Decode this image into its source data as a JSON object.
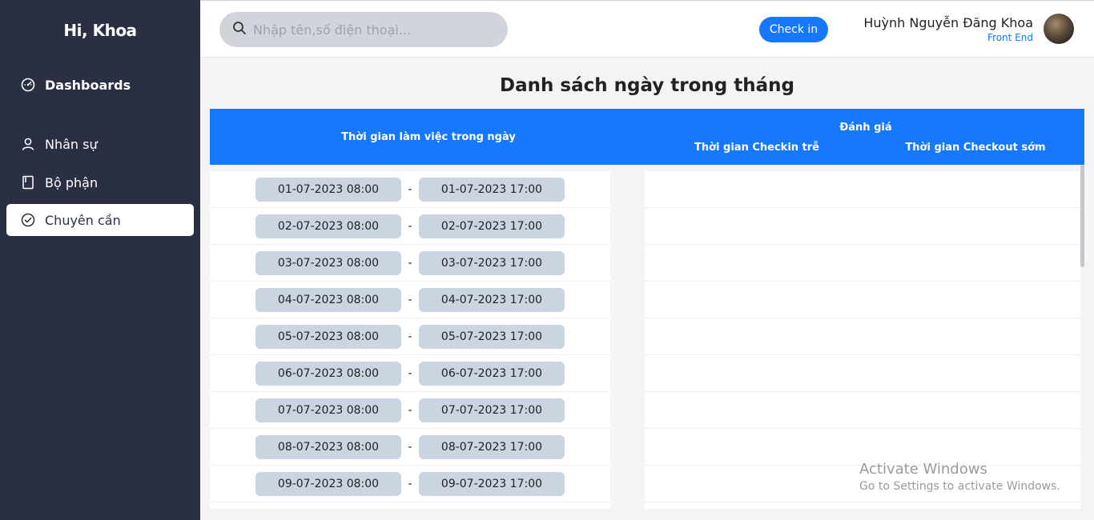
{
  "sidebar": {
    "brand": "Hi, Khoa",
    "items": [
      {
        "label": "Dashboards",
        "icon": "dashboard-icon"
      },
      {
        "label": "Nhân sự",
        "icon": "user-icon"
      },
      {
        "label": "Bộ phận",
        "icon": "book-icon"
      },
      {
        "label": "Chuyên cần",
        "icon": "check-circle-icon",
        "active": true
      }
    ]
  },
  "topbar": {
    "search_placeholder": "Nhập tên,số điện thoại...",
    "checkin_label": "Check in",
    "user_name": "Huỳnh Nguyễn Đăng Khoa",
    "user_role": "Front End"
  },
  "page": {
    "title": "Danh sách ngày trong tháng"
  },
  "table": {
    "headers": {
      "work_time": "Thời gian làm việc trong ngày",
      "evaluation": "Đánh giá",
      "late_checkin": "Thời gian Checkin trễ",
      "early_checkout": "Thời gian Checkout sớm"
    },
    "separator": "-",
    "rows": [
      {
        "start": "01-07-2023 08:00",
        "end": "01-07-2023 17:00"
      },
      {
        "start": "02-07-2023 08:00",
        "end": "02-07-2023 17:00"
      },
      {
        "start": "03-07-2023 08:00",
        "end": "03-07-2023 17:00"
      },
      {
        "start": "04-07-2023 08:00",
        "end": "04-07-2023 17:00"
      },
      {
        "start": "05-07-2023 08:00",
        "end": "05-07-2023 17:00"
      },
      {
        "start": "06-07-2023 08:00",
        "end": "06-07-2023 17:00"
      },
      {
        "start": "07-07-2023 08:00",
        "end": "07-07-2023 17:00"
      },
      {
        "start": "08-07-2023 08:00",
        "end": "08-07-2023 17:00"
      },
      {
        "start": "09-07-2023 08:00",
        "end": "09-07-2023 17:00"
      }
    ]
  },
  "watermark": {
    "line1": "Activate Windows",
    "line2": "Go to Settings to activate Windows."
  }
}
